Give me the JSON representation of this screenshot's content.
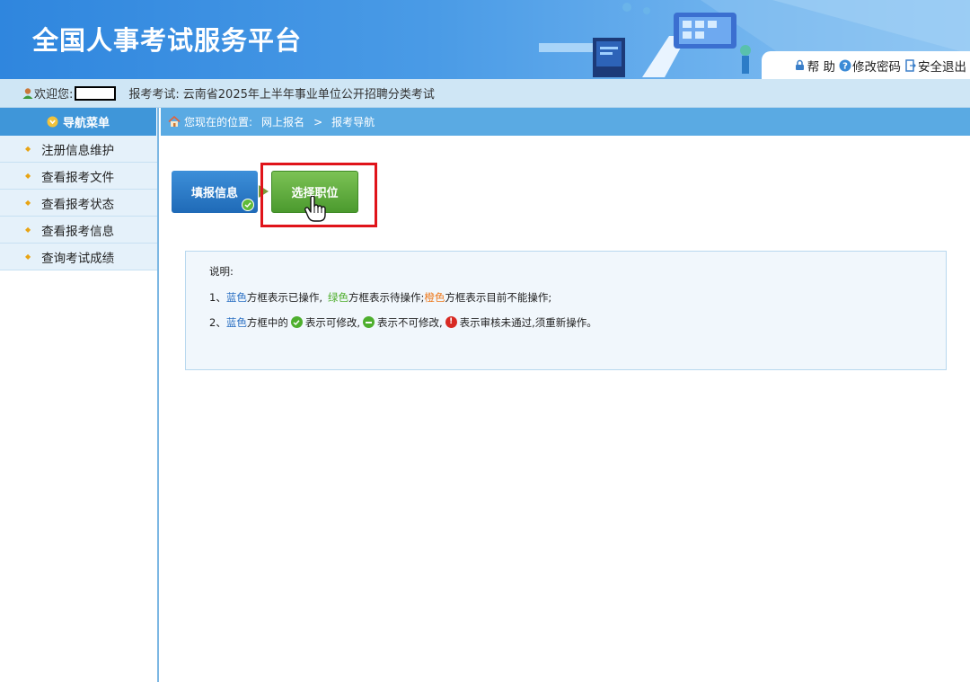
{
  "header": {
    "title": "全国人事考试服务平台",
    "links": [
      {
        "icon": "lock-icon",
        "label": "帮 助"
      },
      {
        "icon": "question-icon",
        "label": "修改密码"
      },
      {
        "icon": "logout-icon",
        "label": "安全退出"
      }
    ]
  },
  "welcome": {
    "prefix": "欢迎您:",
    "exam_label": "报考考试:",
    "exam_name": "云南省2025年上半年事业单位公开招聘分类考试"
  },
  "sidebar": {
    "title": "导航菜单",
    "items": [
      {
        "label": "注册信息维护"
      },
      {
        "label": "查看报考文件"
      },
      {
        "label": "查看报考状态"
      },
      {
        "label": "查看报考信息"
      },
      {
        "label": "查询考试成绩"
      }
    ]
  },
  "breadcrumb": {
    "prefix": "您现在的位置:",
    "items": [
      "网上报名",
      "报考导航"
    ],
    "separator": ">"
  },
  "steps": {
    "fill_info": "填报信息",
    "select_position": "选择职位"
  },
  "info": {
    "title": "说明:",
    "line1_num": "1、",
    "blue": "蓝色",
    "line1_a": "方框表示已操作,",
    "green": "绿色",
    "line1_b": "方框表示待操作;",
    "orange": "橙色",
    "line1_c": "方框表示目前不能操作;",
    "line2_num": "2、",
    "line2_a": "方框中的",
    "line2_b": "表示可修改,",
    "line2_c": "表示不可修改,",
    "line2_d": "表示审核未通过,须重新操作。"
  },
  "colors": {
    "header_blue": "#2f86de",
    "step_blue": "#1f6ab7",
    "step_green": "#4b9a2e",
    "highlight_red": "#e0141a",
    "orange_text": "#ee7a1e"
  }
}
